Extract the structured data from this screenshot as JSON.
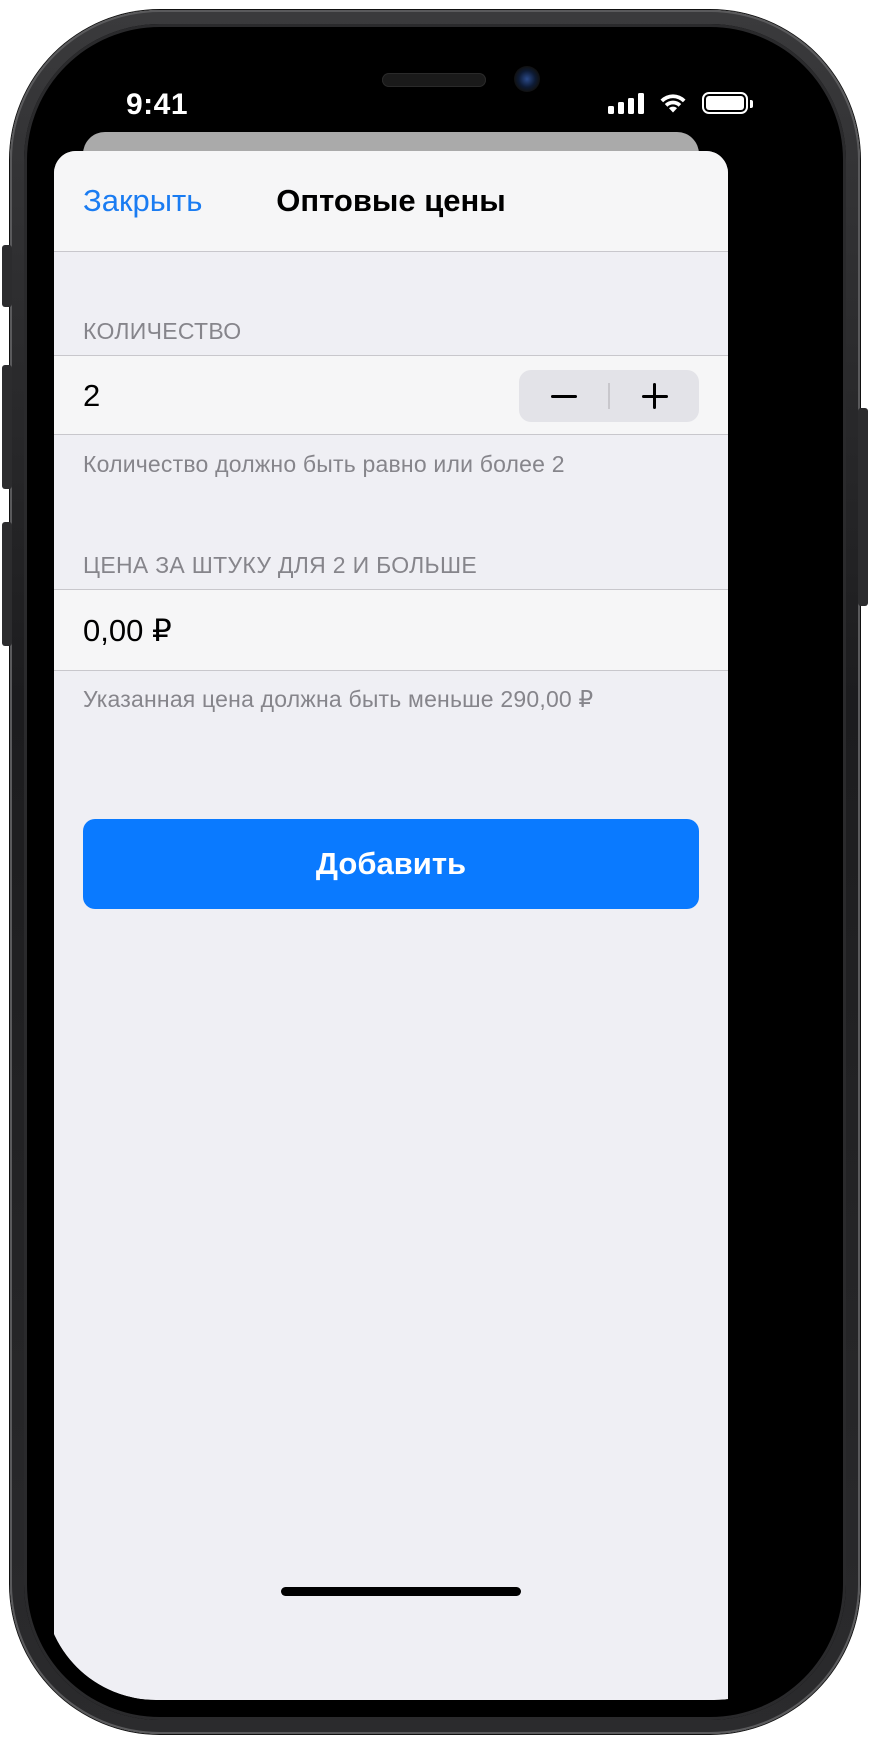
{
  "status_bar": {
    "time": "9:41",
    "icons": [
      "signal-icon",
      "wifi-icon",
      "battery-icon"
    ]
  },
  "nav": {
    "close_label": "Закрыть",
    "title": "Оптовые цены"
  },
  "quantity_section": {
    "header": "КОЛИЧЕСТВО",
    "value": "2",
    "footer": "Количество должно быть равно или более 2"
  },
  "price_section": {
    "header": "ЦЕНА ЗА ШТУКУ ДЛЯ 2 И БОЛЬШЕ",
    "value": "0,00 ₽",
    "footer": "Указанная цена должна быть меньше 290,00 ₽"
  },
  "add_button_label": "Добавить",
  "colors": {
    "accent": "#1a7cf2",
    "button_bg": "#0a7aff",
    "sheet_bg": "#efeff4",
    "cell_bg": "#f6f6f7",
    "secondary_text": "#86858b"
  }
}
